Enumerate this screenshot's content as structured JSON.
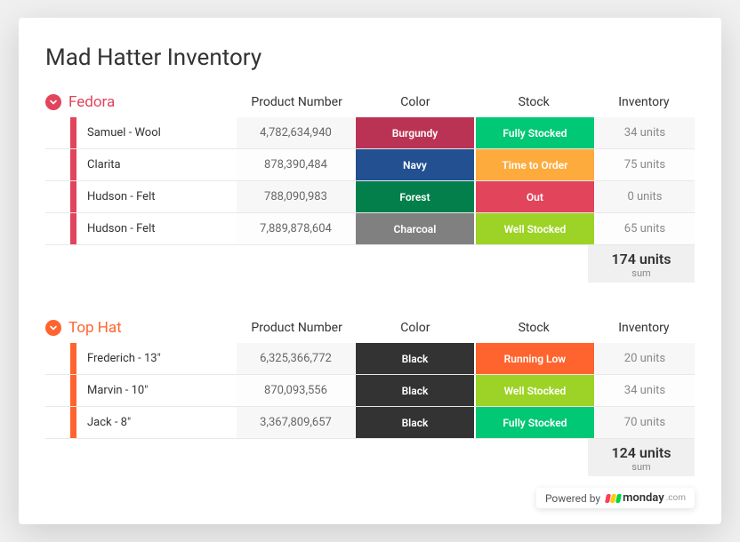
{
  "title": "Mad Hatter Inventory",
  "columns": {
    "product_number": "Product Number",
    "color": "Color",
    "stock": "Stock",
    "inventory": "Inventory"
  },
  "summary_label": "sum",
  "powered_by": "Powered by",
  "brand": "monday",
  "brand_suffix": ".com",
  "groups": [
    {
      "name": "Fedora",
      "accent": "#e2445c",
      "rows": [
        {
          "name": "Samuel - Wool",
          "product_number": "4,782,634,940",
          "color": "Burgundy",
          "color_bg": "#bb3354",
          "stock": "Fully Stocked",
          "stock_bg": "#00c875",
          "inventory": "34 units"
        },
        {
          "name": "Clarita",
          "product_number": "878,390,484",
          "color": "Navy",
          "color_bg": "#225091",
          "stock": "Time to Order",
          "stock_bg": "#fdab3d",
          "inventory": "75 units"
        },
        {
          "name": "Hudson - Felt",
          "product_number": "788,090,983",
          "color": "Forest",
          "color_bg": "#037f4c",
          "stock": "Out",
          "stock_bg": "#e2445c",
          "inventory": "0 units"
        },
        {
          "name": "Hudson - Felt",
          "product_number": "7,889,878,604",
          "color": "Charcoal",
          "color_bg": "#808080",
          "stock": "Well Stocked",
          "stock_bg": "#9cd326",
          "inventory": "65 units"
        }
      ],
      "summary": "174 units"
    },
    {
      "name": "Top Hat",
      "accent": "#ff642e",
      "rows": [
        {
          "name": "Frederich - 13\"",
          "product_number": "6,325,366,772",
          "color": "Black",
          "color_bg": "#333333",
          "stock": "Running Low",
          "stock_bg": "#ff642e",
          "inventory": "20 units"
        },
        {
          "name": "Marvin - 10\"",
          "product_number": "870,093,556",
          "color": "Black",
          "color_bg": "#333333",
          "stock": "Well Stocked",
          "stock_bg": "#9cd326",
          "inventory": "34 units"
        },
        {
          "name": "Jack - 8\"",
          "product_number": "3,367,809,657",
          "color": "Black",
          "color_bg": "#333333",
          "stock": "Fully Stocked",
          "stock_bg": "#00c875",
          "inventory": "70 units"
        }
      ],
      "summary": "124 units"
    }
  ]
}
